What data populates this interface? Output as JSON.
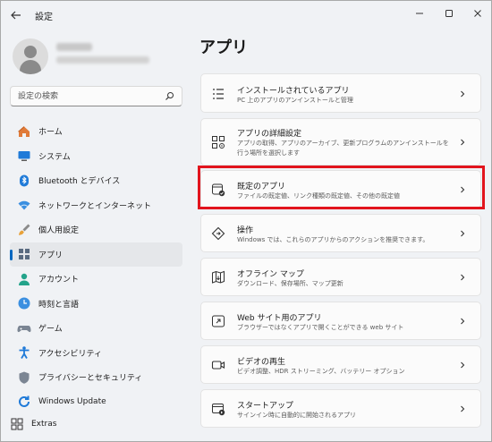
{
  "window": {
    "title": "設定"
  },
  "search": {
    "placeholder": "設定の検索"
  },
  "nav": {
    "items": [
      {
        "label": "ホーム",
        "icon": "home-icon",
        "selected": false
      },
      {
        "label": "システム",
        "icon": "monitor-icon",
        "selected": false
      },
      {
        "label": "Bluetooth とデバイス",
        "icon": "bluetooth-icon",
        "selected": false
      },
      {
        "label": "ネットワークとインターネット",
        "icon": "wifi-icon",
        "selected": false
      },
      {
        "label": "個人用設定",
        "icon": "brush-icon",
        "selected": false
      },
      {
        "label": "アプリ",
        "icon": "apps-icon",
        "selected": true
      },
      {
        "label": "アカウント",
        "icon": "account-icon",
        "selected": false
      },
      {
        "label": "時刻と言語",
        "icon": "clock-globe-icon",
        "selected": false
      },
      {
        "label": "ゲーム",
        "icon": "gamepad-icon",
        "selected": false
      },
      {
        "label": "アクセシビリティ",
        "icon": "accessibility-icon",
        "selected": false
      },
      {
        "label": "プライバシーとセキュリティ",
        "icon": "shield-icon",
        "selected": false
      },
      {
        "label": "Windows Update",
        "icon": "update-icon",
        "selected": false
      }
    ],
    "extras": {
      "label": "Extras",
      "icon": "extras-icon"
    }
  },
  "main": {
    "title": "アプリ",
    "cards": [
      {
        "title": "インストールされているアプリ",
        "desc": "PC 上のアプリのアンインストールと管理",
        "icon": "installed-apps-icon"
      },
      {
        "title": "アプリの詳細設定",
        "desc": "アプリの取得、アプリのアーカイブ、更新プログラムのアンインストールを行う場所を選択します",
        "icon": "advanced-apps-icon"
      },
      {
        "title": "既定のアプリ",
        "desc": "ファイルの既定値、リンク種類の既定値、その他の既定値",
        "icon": "default-apps-icon"
      },
      {
        "title": "操作",
        "desc": "Windows では、これらのアプリからのアクションを推奨できます。",
        "icon": "actions-icon"
      },
      {
        "title": "オフライン マップ",
        "desc": "ダウンロード、保存場所、マップ更新",
        "icon": "offline-maps-icon"
      },
      {
        "title": "Web サイト用のアプリ",
        "desc": "ブラウザーではなくアプリで開くことができる web サイト",
        "icon": "web-apps-icon"
      },
      {
        "title": "ビデオの再生",
        "desc": "ビデオ調整、HDR ストリーミング、バッテリー オプション",
        "icon": "video-icon"
      },
      {
        "title": "スタートアップ",
        "desc": "サインイン時に自動的に開始されるアプリ",
        "icon": "startup-icon"
      }
    ]
  },
  "colors": {
    "accent": "#0067c0",
    "highlight": "#e2141d"
  }
}
